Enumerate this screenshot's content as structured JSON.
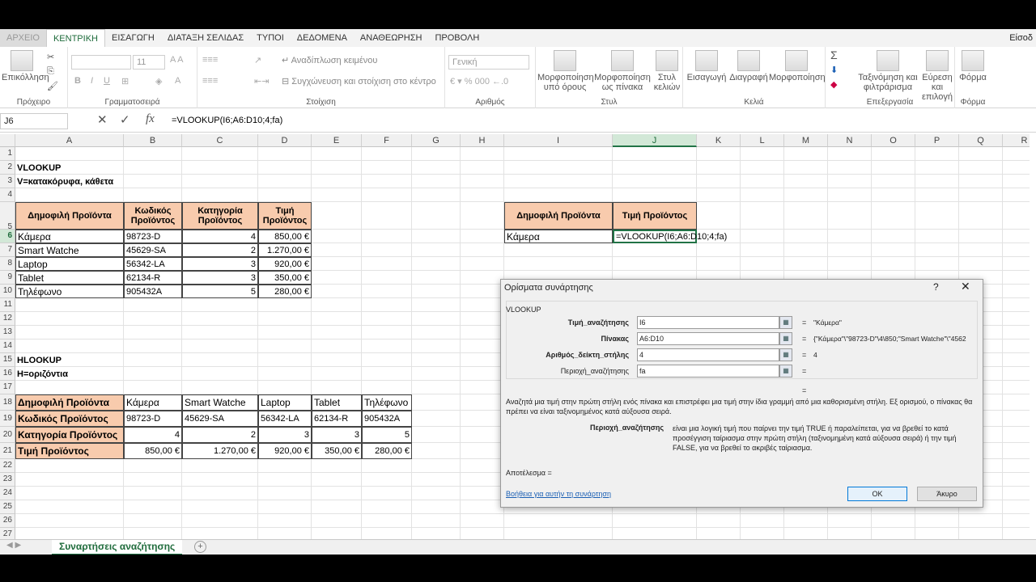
{
  "tabs": [
    "ΑΡΧΕΙΟ",
    "ΚΕΝΤΡΙΚΗ",
    "ΕΙΣΑΓΩΓΗ",
    "ΔΙΑΤΑΞΗ ΣΕΛΙΔΑΣ",
    "ΤΥΠΟΙ",
    "ΔΕΔΟΜΕΝΑ",
    "ΑΝΑΘΕΩΡΗΣΗ",
    "ΠΡΟΒΟΛΗ"
  ],
  "signin": "Είσοδ",
  "ribbon": {
    "paste": "Επικόλληση",
    "clipboard": "Πρόχειρο",
    "font_size": "11",
    "font_group": "Γραμματοσειρά",
    "wrap": "Αναδίπλωση κειμένου",
    "merge": "Συγχώνευση και στοίχιση στο κέντρο",
    "align_group": "Στοίχιση",
    "number_format": "Γενική",
    "number_group": "Αριθμός",
    "cond_format": "Μορφοποίηση υπό όρους",
    "format_table": "Μορφοποίηση ως πίνακα",
    "cell_styles": "Στυλ κελιών",
    "styles_group": "Στυλ",
    "insert": "Εισαγωγή",
    "delete": "Διαγραφή",
    "format": "Μορφοποίηση",
    "cells_group": "Κελιά",
    "sort": "Ταξινόμηση και φιλτράρισμα",
    "find": "Εύρεση και επιλογή",
    "editing_group": "Επεξεργασία",
    "form": "Φόρμα",
    "form_group": "Φόρμα"
  },
  "formula_bar": {
    "name_box": "J6",
    "formula": "=VLOOKUP(I6;A6:D10;4;fa)"
  },
  "columns": [
    "A",
    "B",
    "C",
    "D",
    "E",
    "F",
    "G",
    "H",
    "I",
    "J",
    "K",
    "L",
    "M",
    "N",
    "O",
    "P",
    "Q",
    "R"
  ],
  "rows": [
    "1",
    "2",
    "3",
    "4",
    "5",
    "6",
    "7",
    "8",
    "9",
    "10",
    "11",
    "12",
    "13",
    "14",
    "15",
    "16",
    "17",
    "18",
    "19",
    "20",
    "21",
    "22",
    "23",
    "24",
    "25",
    "26",
    "27"
  ],
  "sheet": {
    "title_vlookup": "VLOOKUP",
    "v_desc": "V=κατακόρυφα, κάθετα",
    "table1_headers": [
      "Δημοφιλή Προϊόντα",
      "Κωδικός Προϊόντος",
      "Κατηγορία Προϊόντος",
      "Τιμή Προϊόντος"
    ],
    "table1_rows": [
      [
        "Κάμερα",
        "98723-D",
        "4",
        "850,00 €"
      ],
      [
        "Smart Watche",
        "45629-SA",
        "2",
        "1.270,00 €"
      ],
      [
        "Laptop",
        "56342-LA",
        "3",
        "920,00 €"
      ],
      [
        "Tablet",
        "62134-R",
        "3",
        "350,00 €"
      ],
      [
        "Τηλέφωνο",
        "905432A",
        "5",
        "280,00 €"
      ]
    ],
    "lookup_headers": [
      "Δημοφιλή Προϊόντα",
      "Τιμή Προϊόντος"
    ],
    "lookup_value": "Κάμερα",
    "lookup_formula": "=VLOOKUP(I6;A6:D10;4;fa)",
    "title_hlookup": "HLOOKUP",
    "h_desc": "H=οριζόντια",
    "table2": [
      [
        "Δημοφιλή Προϊόντα",
        "Κάμερα",
        "Smart Watche",
        "Laptop",
        "Tablet",
        "Τηλέφωνο"
      ],
      [
        "Κωδικός Προϊόντος",
        "98723-D",
        "45629-SA",
        "56342-LA",
        "62134-R",
        "905432A"
      ],
      [
        "Κατηγορία Προϊόντος",
        "4",
        "2",
        "3",
        "3",
        "5"
      ],
      [
        "Τιμή Προϊόντος",
        "850,00 €",
        "1.270,00 €",
        "920,00 €",
        "350,00 €",
        "280,00 €"
      ]
    ]
  },
  "sheet_tab": "Συναρτήσεις αναζήτησης",
  "dialog": {
    "title": "Ορίσματα συνάρτησης",
    "help_glyph": "?",
    "close_glyph": "✕",
    "function_name": "VLOOKUP",
    "args": [
      {
        "label": "Τιμή_αναζήτησης",
        "value": "I6",
        "result": "\"Κάμερα\""
      },
      {
        "label": "Πίνακας",
        "value": "A6:D10",
        "result": "{\"Κάμερα\"\\\"98723-D\"\\4\\850;\"Smart Watche\"\\\"4562"
      },
      {
        "label": "Αριθμός_δείκτη_στήλης",
        "value": "4",
        "result": "4"
      },
      {
        "label": "Περιοχή_αναζήτησης",
        "value": "fa",
        "result": ""
      }
    ],
    "eq_sign": "=",
    "description": "Αναζητά μια τιμή στην πρώτη στήλη ενός πίνακα και επιστρέφει μια τιμή στην ίδια γραμμή από μια καθορισμένη στήλη. Εξ ορισμού, ο πίνακας θα πρέπει να είναι ταξινομημένος κατά αύξουσα σειρά.",
    "param_name": "Περιοχή_αναζήτησης",
    "param_desc": "είναι μια λογική τιμή που παίρνει την τιμή TRUE ή παραλείπεται, για να βρεθεί το κατά προσέγγιση ταίριασμα στην πρώτη στήλη (ταξινομημένη κατά αύξουσα σειρά) ή την τιμή FALSE, για να βρεθεί το ακριβές ταίριασμα.",
    "result_label": "Αποτέλεσμα =",
    "help_link": "Βοήθεια για αυτήν τη συνάρτηση",
    "ok": "OK",
    "cancel": "Άκυρο"
  }
}
